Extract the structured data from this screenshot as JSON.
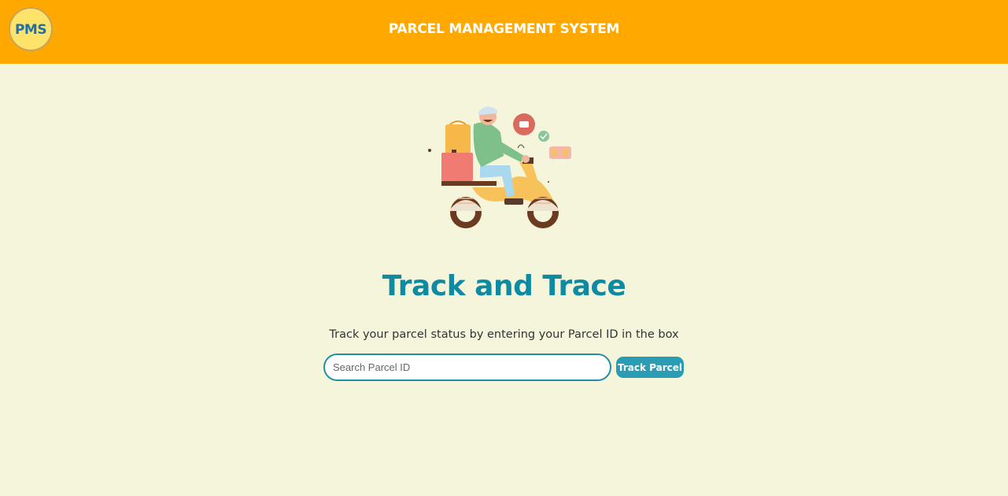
{
  "header": {
    "logo_text": "PMS",
    "logo_subtext": "PARCEL MANAGEMENT SYSTEM",
    "title": "PARCEL MANAGEMENT SYSTEM"
  },
  "main": {
    "heading": "Track and Trace",
    "subtitle": "Track your parcel status by entering your Parcel ID in the box",
    "search": {
      "placeholder": "Search Parcel ID",
      "value": ""
    },
    "track_button_label": "Track Parcel"
  },
  "colors": {
    "header_bg": "#ffa800",
    "page_bg": "#f5f5dc",
    "heading": "#0e8aa3",
    "button_bg": "#2a9db5",
    "input_border": "#1e8fa5"
  },
  "illustration": {
    "icon": "delivery-scooter-illustration"
  }
}
